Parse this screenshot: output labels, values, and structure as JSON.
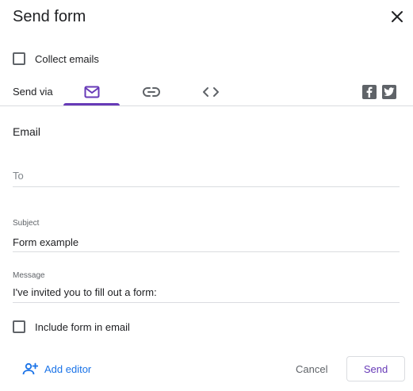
{
  "dialog": {
    "title": "Send form"
  },
  "collect_emails": {
    "label": "Collect emails",
    "checked": false
  },
  "send_via": {
    "label": "Send via",
    "tabs": [
      {
        "name": "email",
        "icon": "mail-icon",
        "active": true
      },
      {
        "name": "link",
        "icon": "link-icon",
        "active": false
      },
      {
        "name": "embed",
        "icon": "code-icon",
        "active": false
      }
    ],
    "social": [
      "facebook-icon",
      "twitter-icon"
    ]
  },
  "email": {
    "section_title": "Email",
    "to_placeholder": "To",
    "subject_label": "Subject",
    "subject_value": "Form example",
    "message_label": "Message",
    "message_value": "I've invited you to fill out a form:",
    "include_form_label": "Include form in email",
    "include_form_checked": false
  },
  "footer": {
    "add_editor": "Add editor",
    "cancel": "Cancel",
    "send": "Send"
  },
  "colors": {
    "accent": "#673ab7",
    "link": "#1a73e8",
    "icon": "#5f6368",
    "divider": "#dadce0"
  }
}
